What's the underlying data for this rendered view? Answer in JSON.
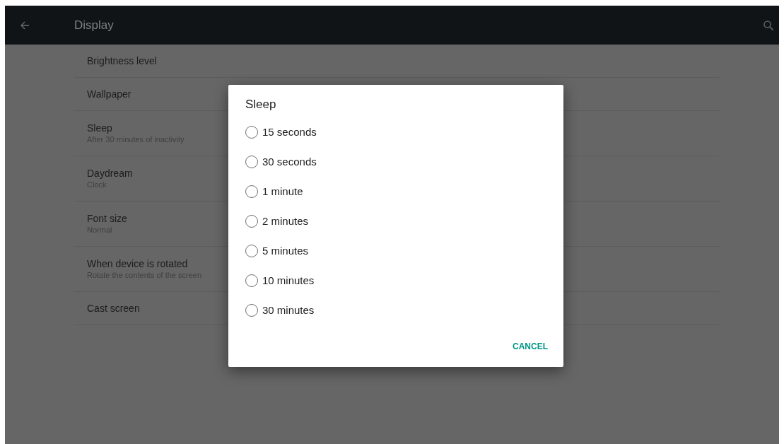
{
  "app_bar": {
    "title": "Display"
  },
  "settings": [
    {
      "title": "Brightness level"
    },
    {
      "title": "Wallpaper"
    },
    {
      "title": "Sleep",
      "summary": "After 30 minutes of inactivity"
    },
    {
      "title": "Daydream",
      "summary": "Clock"
    },
    {
      "title": "Font size",
      "summary": "Normal"
    },
    {
      "title": "When device is rotated",
      "summary": "Rotate the contents of the screen"
    },
    {
      "title": "Cast screen"
    }
  ],
  "dialog": {
    "title": "Sleep",
    "options": [
      {
        "label": "15 seconds",
        "selected": false
      },
      {
        "label": "30 seconds",
        "selected": false
      },
      {
        "label": "1 minute",
        "selected": false
      },
      {
        "label": "2 minutes",
        "selected": false
      },
      {
        "label": "5 minutes",
        "selected": false
      },
      {
        "label": "10 minutes",
        "selected": false
      },
      {
        "label": "30 minutes",
        "selected": false
      }
    ],
    "buttons": [
      "CANCEL"
    ]
  }
}
